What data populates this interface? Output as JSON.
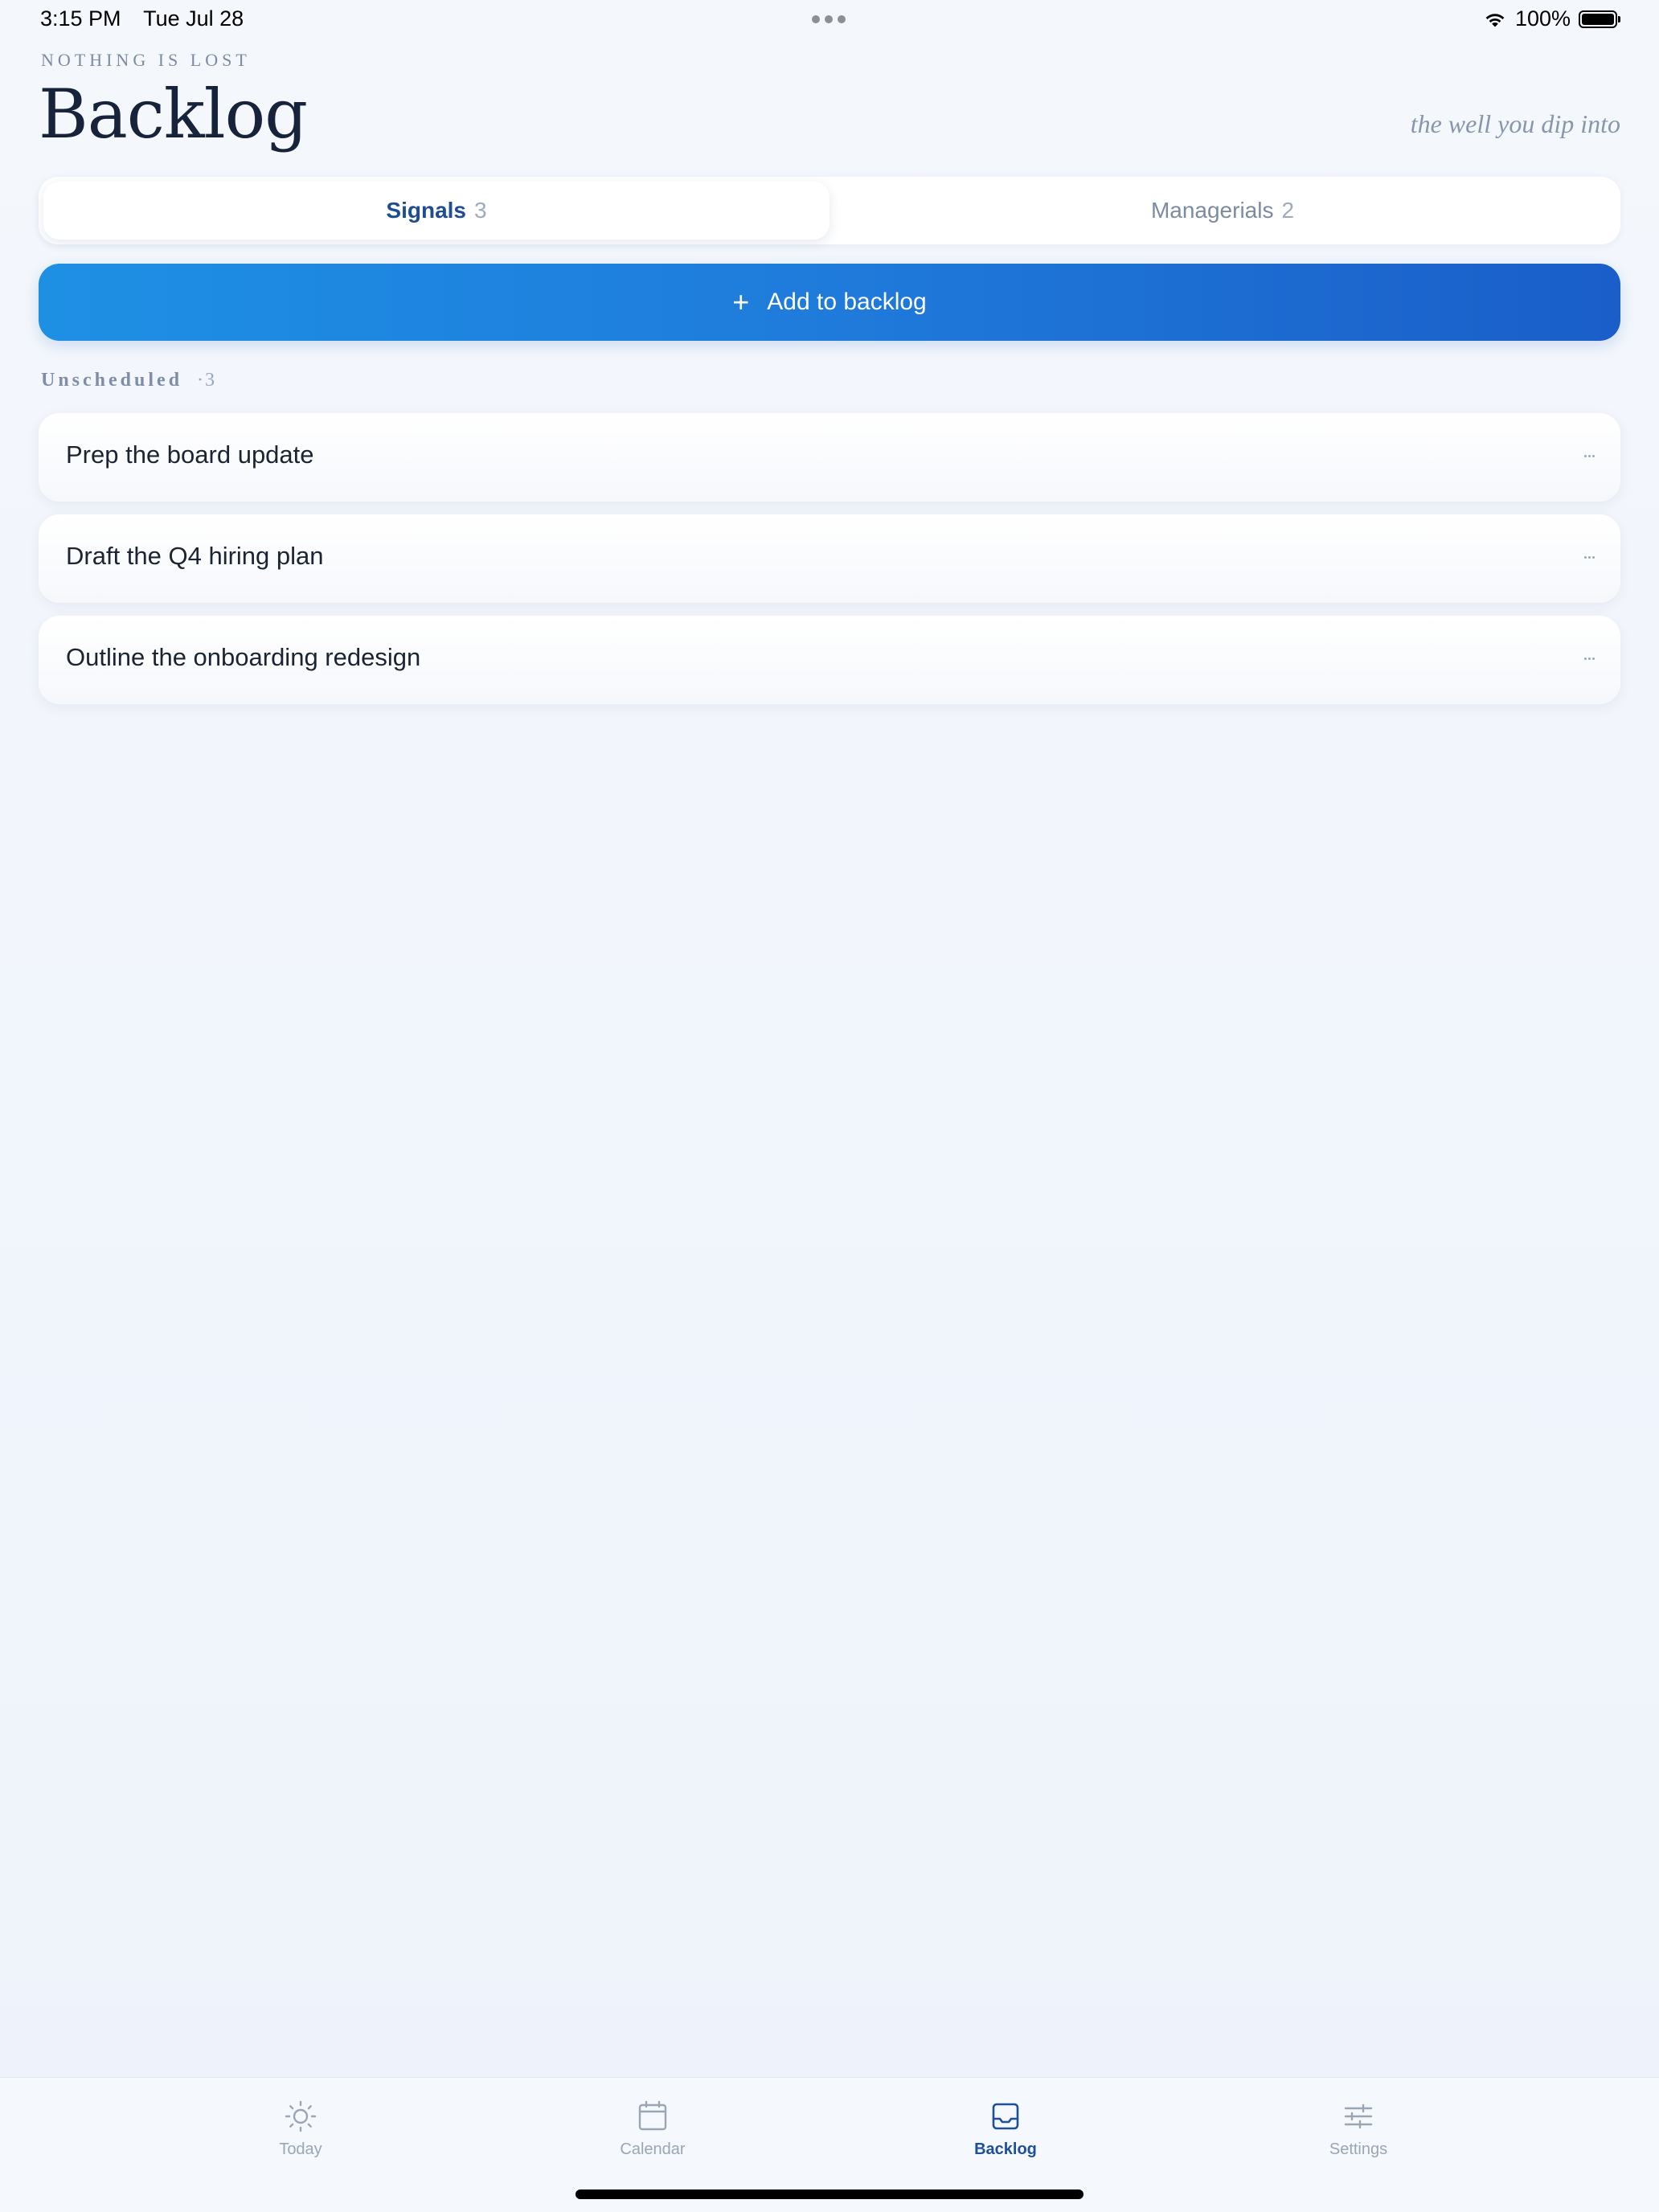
{
  "status_bar": {
    "time": "3:15 PM",
    "date": "Tue Jul 28",
    "battery": "100%"
  },
  "header": {
    "eyebrow": "NOTHING IS LOST",
    "title": "Backlog",
    "tagline": "the well you dip into"
  },
  "segments": [
    {
      "label": "Signals",
      "count": "3",
      "active": true
    },
    {
      "label": "Managerials",
      "count": "2",
      "active": false
    }
  ],
  "add_button": {
    "icon": "plus-icon",
    "label": "Add to backlog"
  },
  "section": {
    "label": "Unscheduled",
    "count": "·3"
  },
  "items": [
    {
      "title": "Prep the board update"
    },
    {
      "title": "Draft the Q4 hiring plan"
    },
    {
      "title": "Outline the onboarding redesign"
    }
  ],
  "tabs": [
    {
      "label": "Today",
      "icon": "sun-icon",
      "active": false
    },
    {
      "label": "Calendar",
      "icon": "calendar-icon",
      "active": false
    },
    {
      "label": "Backlog",
      "icon": "inbox-icon",
      "active": true
    },
    {
      "label": "Settings",
      "icon": "sliders-icon",
      "active": false
    }
  ],
  "colors": {
    "accent": "#1d4f9a",
    "button_gradient_start": "#1e90e4",
    "button_gradient_end": "#1a5ec9",
    "background": "#f1f5fb"
  }
}
